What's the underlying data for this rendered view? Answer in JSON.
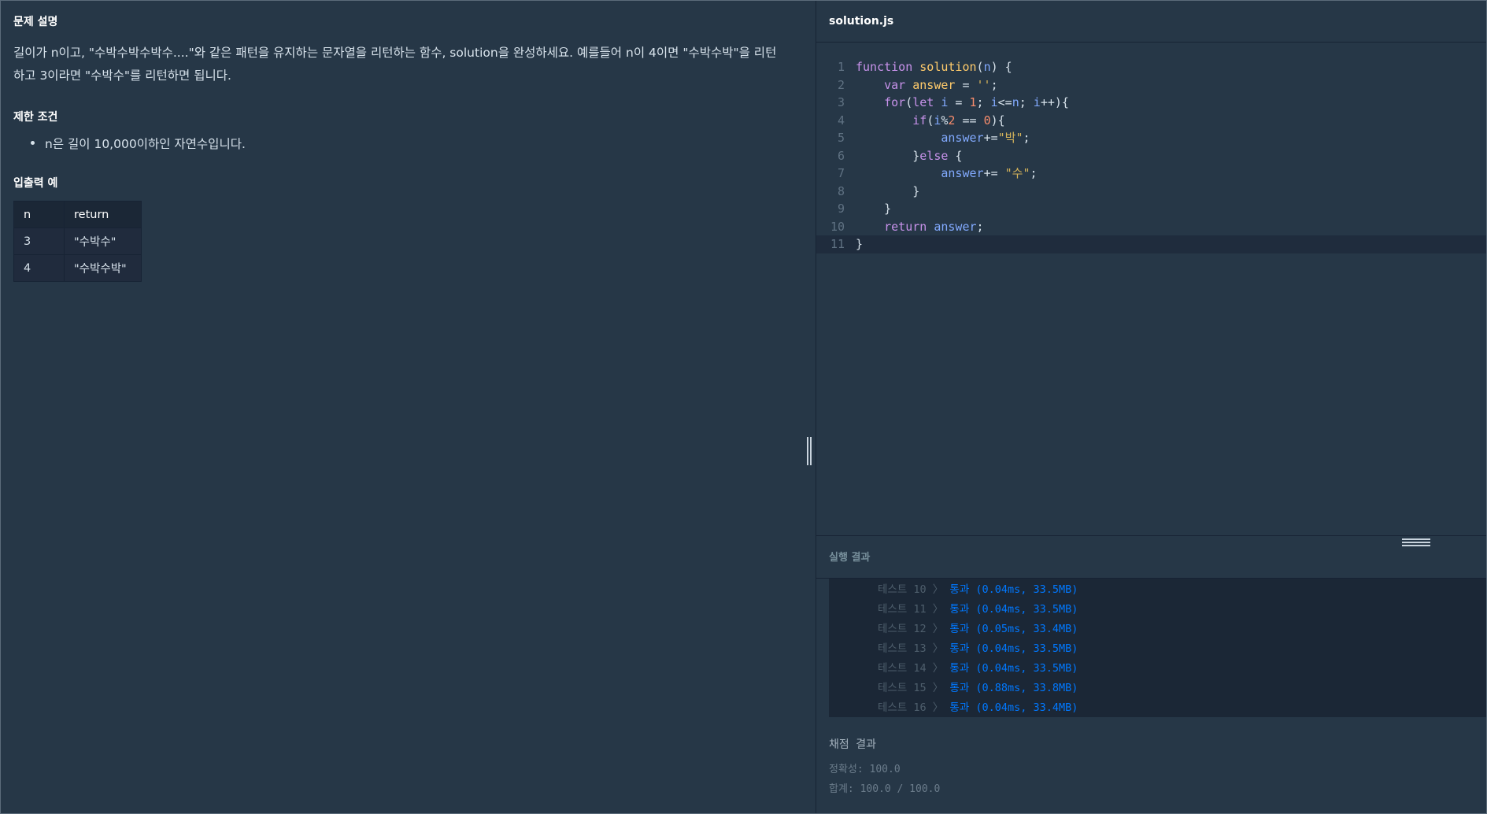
{
  "problem": {
    "section_title": "문제 설명",
    "description_line1": "길이가 n이고, \"수박수박수박수....\"와 같은 패턴을 유지하는 문자열을 리턴하는 함수, solution을 완성하세요. 예를들어 n이 4이면 \"수박수박\"을 리턴",
    "description_line2": "하고 3이라면 \"수박수\"를 리턴하면 됩니다.",
    "constraints_title": "제한 조건",
    "constraints": [
      "n은 길이 10,000이하인 자연수입니다."
    ],
    "examples_title": "입출력 예",
    "table": {
      "headers": [
        "n",
        "return"
      ],
      "rows": [
        [
          "3",
          "\"수박수\""
        ],
        [
          "4",
          "\"수박수박\""
        ]
      ]
    }
  },
  "editor": {
    "file_name": "solution.js",
    "line_numbers": [
      "1",
      "2",
      "3",
      "4",
      "5",
      "6",
      "7",
      "8",
      "9",
      "10",
      "11"
    ],
    "code": {
      "l1_kw": "function",
      "l1_fn": "solution",
      "l1_a": "(",
      "l1_param": "n",
      "l1_b": ") {",
      "l2_kw": "var",
      "l2_var": "answer",
      "l2_a": " = ",
      "l2_str": "''",
      "l2_b": ";",
      "l3_kw": "for",
      "l3_a": "(",
      "l3_kw2": "let",
      "l3_var": "i",
      "l3_b": " = ",
      "l3_num": "1",
      "l3_c": "; ",
      "l3_var2": "i",
      "l3_d": "<=",
      "l3_var3": "n",
      "l3_e": "; ",
      "l3_var4": "i",
      "l3_f": "++){",
      "l4_kw": "if",
      "l4_a": "(",
      "l4_var": "i",
      "l4_b": "%",
      "l4_num": "2",
      "l4_c": " == ",
      "l4_num2": "0",
      "l4_d": "){",
      "l5_var": "answer",
      "l5_a": "+=",
      "l5_str": "\"박\"",
      "l5_b": ";",
      "l6_a": "}",
      "l6_kw": "else",
      "l6_b": " {",
      "l7_var": "answer",
      "l7_a": "+= ",
      "l7_str": "\"수\"",
      "l7_b": ";",
      "l8": "}",
      "l9": "}",
      "l10_kw": "return",
      "l10_var": "answer",
      "l10_a": ";",
      "l11": "}"
    }
  },
  "results": {
    "title": "실행 결과",
    "rows": [
      {
        "label": "테스트 10 〉",
        "status": "통과 (0.04ms, 33.5MB)"
      },
      {
        "label": "테스트 11 〉",
        "status": "통과 (0.04ms, 33.5MB)"
      },
      {
        "label": "테스트 12 〉",
        "status": "통과 (0.05ms, 33.4MB)"
      },
      {
        "label": "테스트 13 〉",
        "status": "통과 (0.04ms, 33.5MB)"
      },
      {
        "label": "테스트 14 〉",
        "status": "통과 (0.04ms, 33.5MB)"
      },
      {
        "label": "테스트 15 〉",
        "status": "통과 (0.88ms, 33.8MB)"
      },
      {
        "label": "테스트 16 〉",
        "status": "통과 (0.04ms, 33.4MB)"
      }
    ],
    "score_title": "채점 결과",
    "accuracy": "정확성: 100.0",
    "total": "합계: 100.0 / 100.0"
  },
  "colors": {
    "background": "#263747",
    "pass": "#0078ff",
    "keyword": "#c792ea",
    "function": "#ffcb6b",
    "variable": "#82aaff"
  }
}
